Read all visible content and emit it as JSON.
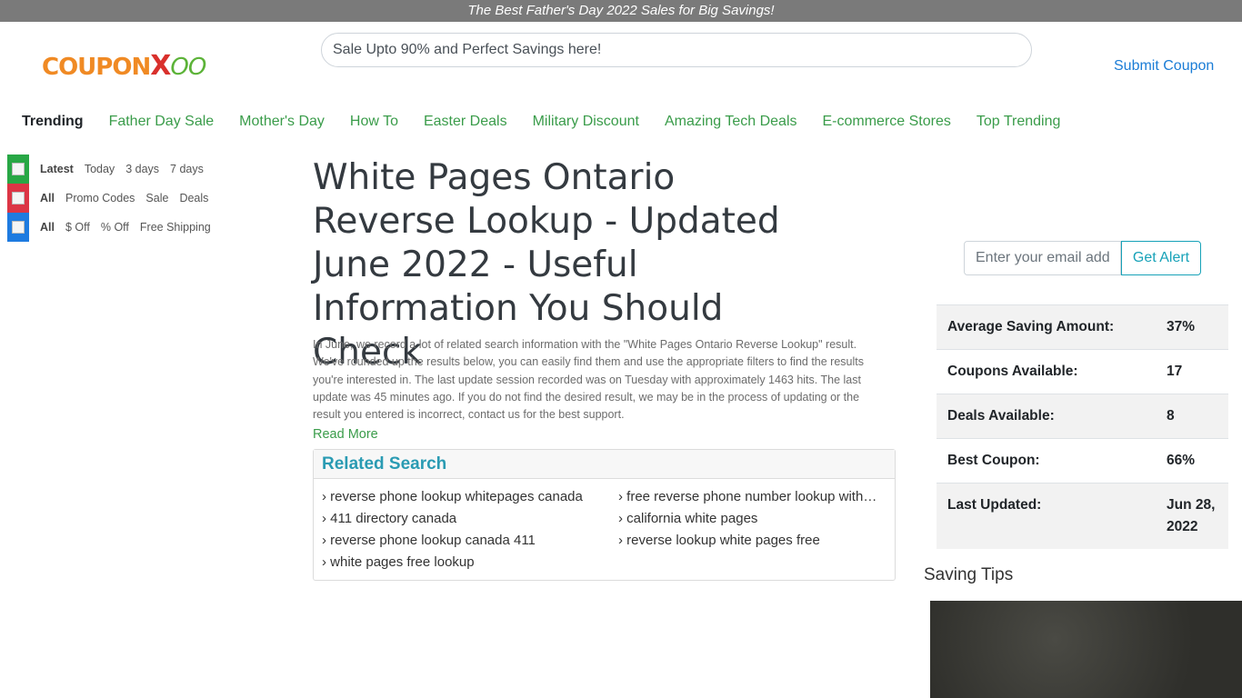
{
  "banner": {
    "text": "The Best Father's Day 2022 Sales for Big Savings!"
  },
  "logo": {
    "part1": "COUPON",
    "part2": "X",
    "part3": "OO"
  },
  "search": {
    "placeholder": "Sale Upto 90% and Perfect Savings here!"
  },
  "header": {
    "submit_coupon": "Submit Coupon"
  },
  "nav": {
    "title": "Trending",
    "items": [
      "Father Day Sale",
      "Mother's Day",
      "How To",
      "Easter Deals",
      "Military Discount",
      "Amazing Tech Deals",
      "E-commerce Stores",
      "Top Trending"
    ]
  },
  "filters": [
    {
      "items": [
        "Latest",
        "Today",
        "3 days",
        "7 days"
      ]
    },
    {
      "items": [
        "All",
        "Promo Codes",
        "Sale",
        "Deals"
      ]
    },
    {
      "items": [
        "All",
        "$ Off",
        "% Off",
        "Free Shipping"
      ]
    }
  ],
  "main": {
    "title": "White Pages Ontario Reverse Lookup - Updated June 2022 - Useful Information You Should Check",
    "intro": "In June, we record a lot of related search information with the \"White Pages Ontario Reverse Lookup\" result. We've rounded up the results below, you can easily find them and use the appropriate filters to find the results you're interested in. The last update session recorded was on Tuesday with approximately 1463 hits. The last update was 45 minutes ago. If you do not find the desired result, we may be in the process of updating or the result you entered is incorrect, contact us for the best support.",
    "read_more": "Read More"
  },
  "related": {
    "title": "Related Search",
    "items": [
      "› reverse phone lookup whitepages canada",
      "› free reverse phone number lookup without fees",
      "› 411 directory canada",
      "› california white pages",
      "› reverse phone lookup canada 411",
      "› reverse lookup white pages free",
      "› white pages free lookup"
    ]
  },
  "alert": {
    "placeholder": "Enter your email address",
    "button": "Get Alert"
  },
  "stats": [
    {
      "label": "Average Saving Amount:",
      "value": "37%"
    },
    {
      "label": "Coupons Available:",
      "value": "17"
    },
    {
      "label": "Deals Available:",
      "value": "8"
    },
    {
      "label": "Best Coupon:",
      "value": "66%"
    },
    {
      "label": "Last Updated:",
      "value": "Jun 28, 2022"
    }
  ],
  "tips": {
    "title": "Saving Tips"
  }
}
